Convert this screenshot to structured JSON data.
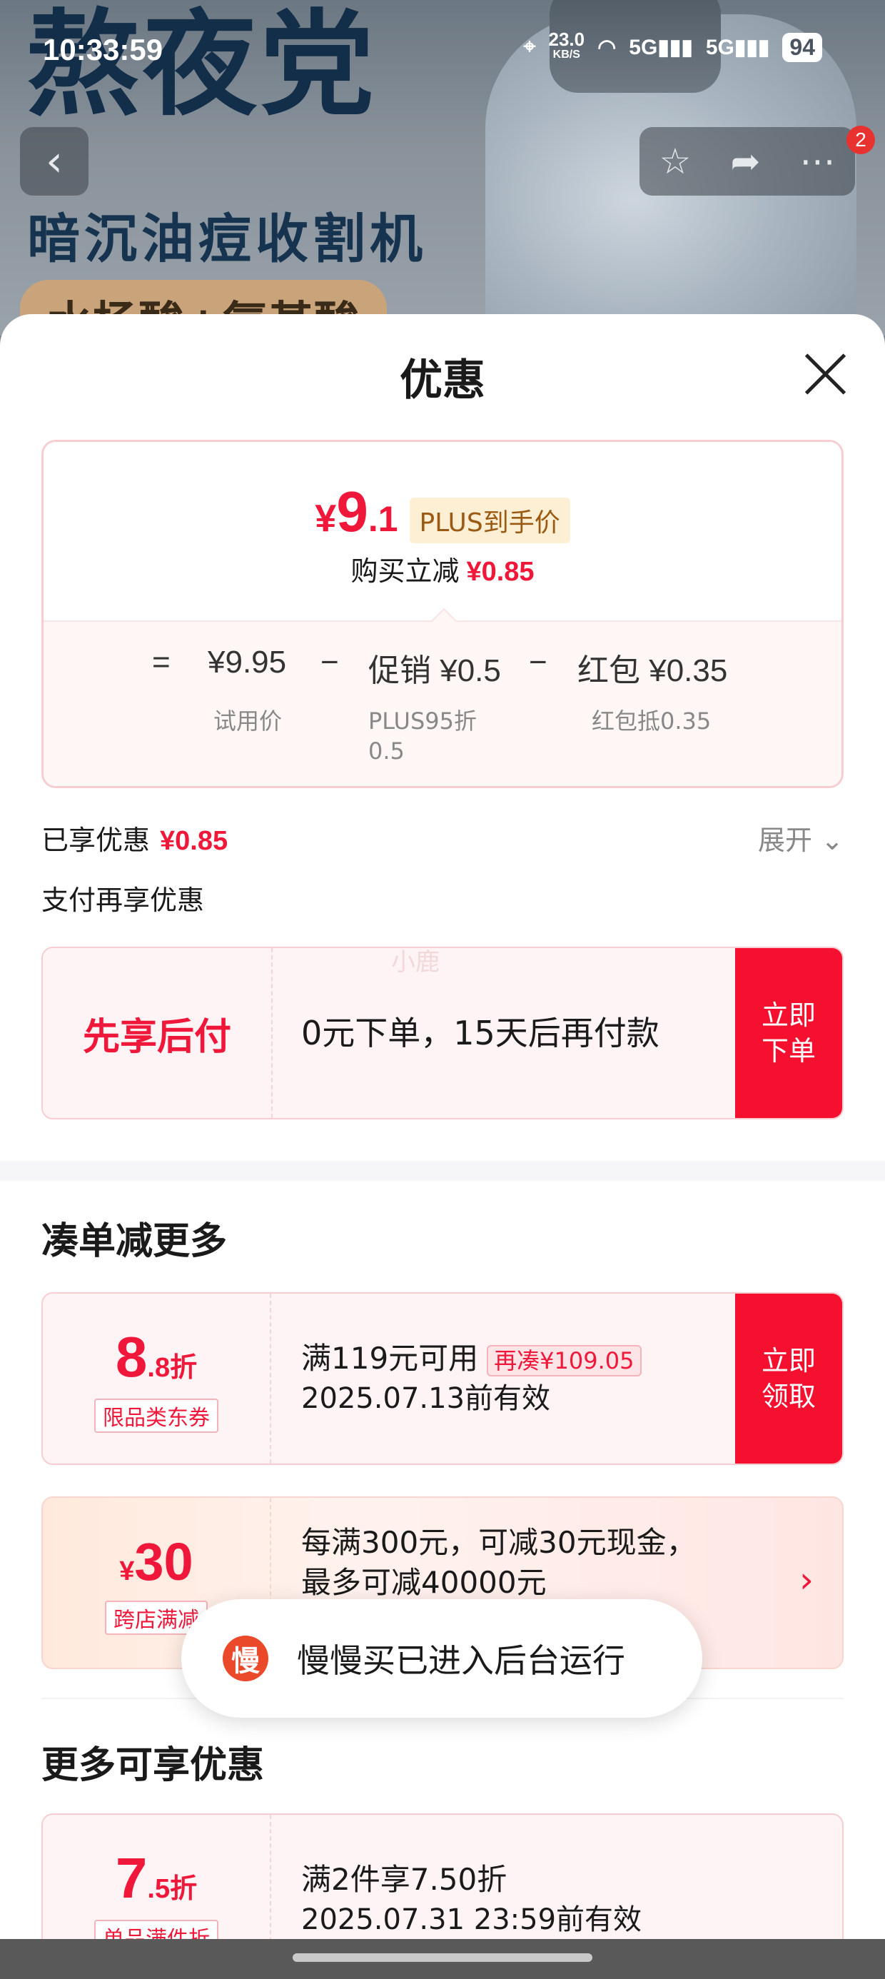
{
  "status_bar": {
    "time": "10:33:59",
    "net_speed": "23.0",
    "net_unit": "KB/S",
    "signal_1": "5G",
    "signal_2": "5G",
    "battery": "94"
  },
  "banner": {
    "headline": "熬夜党",
    "subline": "暗沉油痘收割机",
    "pill": "水杨酸+氨基酸",
    "cart_badge": "2"
  },
  "sheet": {
    "title": "优惠",
    "price_card": {
      "currency": "¥",
      "final_int": "9",
      "final_dec": ".1",
      "plus_tag": "PLUS到手价",
      "reduce_label": "购买立减",
      "reduce_value": "¥0.85",
      "eq": "=",
      "base_price": "¥9.95",
      "base_label": "试用价",
      "minus1": "−",
      "promo": "促销 ¥0.5",
      "promo_label_1": "PLUS95折",
      "promo_label_2": "0.5",
      "minus2": "−",
      "redpack": "红包 ¥0.35",
      "redpack_label": "红包抵0.35"
    },
    "enjoyed_label": "已享优惠",
    "enjoyed_value": "¥0.85",
    "expand_label": "展开",
    "pay_again_label": "支付再享优惠",
    "bnpl": {
      "title": "先享后付",
      "desc": "0元下单，15天后再付款",
      "cta_1": "立即",
      "cta_2": "下单",
      "watermark": "小鹿"
    },
    "more_section_title": "凑单减更多",
    "coupon1": {
      "disc_int": "8",
      "disc_dec": ".8折",
      "tag": "限品类东券",
      "line1": "满119元可用",
      "badge": "再凑¥109.05",
      "line2": "2025.07.13前有效",
      "cta_1": "立即",
      "cta_2": "领取"
    },
    "coupon2": {
      "cur": "¥",
      "amount": "30",
      "tag": "跨店满减",
      "line1": "每满300元，可减30元现金，",
      "line2": "最多可减40000元"
    },
    "extra_section_title": "更多可享优惠",
    "coupon3": {
      "disc_int": "7",
      "disc_dec": ".5折",
      "tag": "单品满件折",
      "line1": "满2件享7.50折",
      "line2": "2025.07.31 23:59前有效"
    }
  },
  "toast": {
    "icon_char": "慢",
    "text": "慢慢买已进入后台运行"
  }
}
